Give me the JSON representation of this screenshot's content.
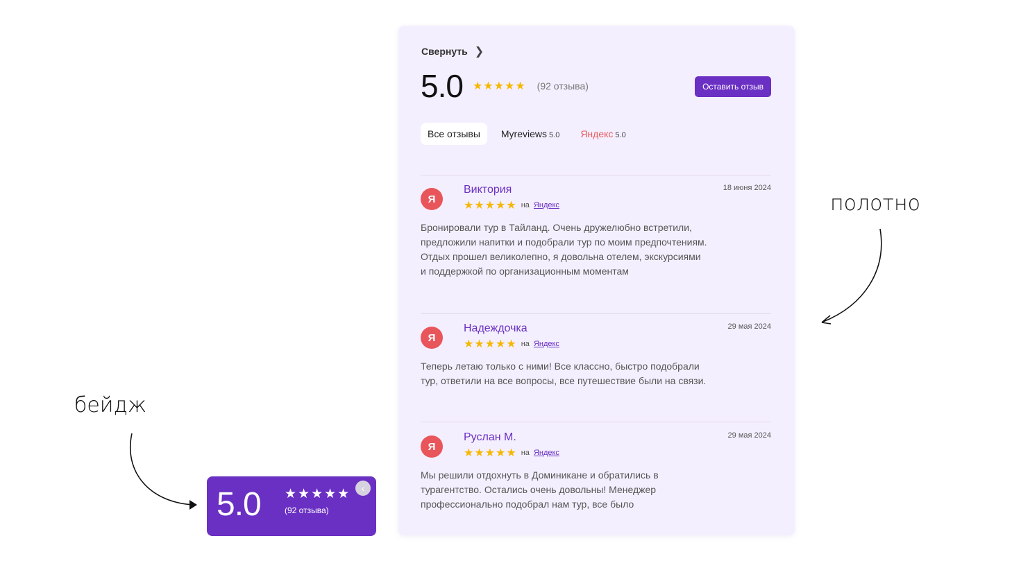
{
  "widget": {
    "collapse_label": "Свернуть",
    "collapse_icon": "chevron-right-icon",
    "score": "5.0",
    "stars": "★★★★★",
    "review_count": "(92 отзыва)",
    "leave_review_label": "Оставить отзыв",
    "tabs": [
      {
        "label": "Все отзывы",
        "score": "",
        "active": true
      },
      {
        "label": "Myreviews",
        "score": "5.0",
        "active": false
      },
      {
        "label": "Яндекс",
        "score": "5.0",
        "active": false
      }
    ],
    "reviews": [
      {
        "avatar_letter": "Я",
        "name": "Виктория",
        "stars": "★★★★★",
        "source_prefix": "на",
        "source": "Яндекс",
        "date": "18 июня 2024",
        "text": "Бронировали тур в Тайланд. Очень дружелюбно встретили, предложили напитки и подобрали тур по моим предпочтениям. Отдых прошел великолепно, я довольна отелем, экскурсиями и поддержкой по организационным моментам"
      },
      {
        "avatar_letter": "Я",
        "name": "Надеждочка",
        "stars": "★★★★★",
        "source_prefix": "на",
        "source": "Яндекс",
        "date": "29 мая 2024",
        "text": "Теперь летаю только с ними! Все классно, быстро подобрали тур, ответили на все вопросы, все путешествие были на связи."
      },
      {
        "avatar_letter": "Я",
        "name": "Руслан М.",
        "stars": "★★★★★",
        "source_prefix": "на",
        "source": "Яндекс",
        "date": "29 мая 2024",
        "text": "Мы решили отдохнуть в Доминикане и обратились в турагентство. Остались очень довольны! Менеджер профессионально подобрал нам тур, все было"
      }
    ]
  },
  "annotations": {
    "canvas_label": "полотно",
    "badge_label": "бейдж"
  },
  "badge": {
    "score": "5.0",
    "stars": "★★★★★",
    "review_count": "(92 отзыва)",
    "close_icon": "chevron-left-icon"
  },
  "colors": {
    "accent": "#6a2fc3",
    "panel_bg": "#f4effe",
    "star": "#f5b800",
    "yandex_red": "#e8555a"
  }
}
